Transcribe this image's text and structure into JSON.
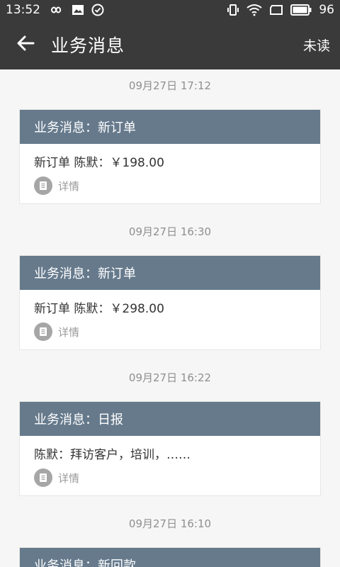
{
  "status_bar": {
    "time": "13:52",
    "battery": "96",
    "icons": [
      "infinity-icon",
      "image-icon",
      "check-circle-icon",
      "vibrate-icon",
      "wifi-icon",
      "sim-icon",
      "battery-icon"
    ]
  },
  "app_bar": {
    "title": "业务消息",
    "unread_label": "未读",
    "back_icon": "arrow-left-icon"
  },
  "messages": [
    {
      "timestamp": "09月27日 17:12",
      "title": "业务消息：新订单",
      "summary": "新订单 陈默：￥198.00",
      "detail_label": "详情"
    },
    {
      "timestamp": "09月27日 16:30",
      "title": "业务消息：新订单",
      "summary": "新订单 陈默：￥298.00",
      "detail_label": "详情"
    },
    {
      "timestamp": "09月27日 16:22",
      "title": "业务消息：日报",
      "summary": "陈默：拜访客户，培训，……",
      "detail_label": "详情"
    },
    {
      "timestamp": "09月27日 16:10",
      "title": "业务消息：新回款"
    }
  ],
  "colors": {
    "app_bar": "#3a3a3a",
    "card_header": "#667a8c",
    "background": "#f6f6f6"
  }
}
